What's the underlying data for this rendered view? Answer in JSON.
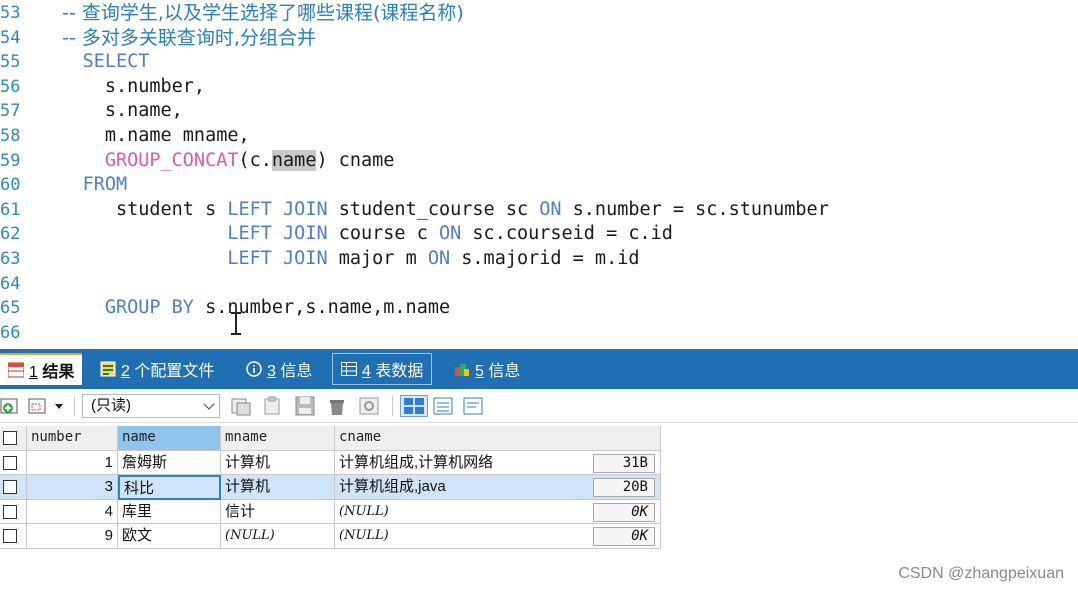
{
  "editor": {
    "lines": [
      {
        "no": "53",
        "parts": [
          {
            "t": "    -- 查询学生,以及学生选择了哪些课程(课程名称)",
            "c": "cm"
          }
        ]
      },
      {
        "no": "54",
        "parts": [
          {
            "t": "    -- 多对多关联查询时,分组合并",
            "c": "cm"
          }
        ]
      },
      {
        "no": "55",
        "parts": [
          {
            "t": "    ",
            "c": ""
          },
          {
            "t": "SELECT",
            "c": "kw"
          }
        ]
      },
      {
        "no": "56",
        "parts": [
          {
            "t": "      s.number,",
            "c": ""
          }
        ]
      },
      {
        "no": "57",
        "parts": [
          {
            "t": "      s.name,",
            "c": ""
          }
        ]
      },
      {
        "no": "58",
        "parts": [
          {
            "t": "      m.name mname,",
            "c": ""
          }
        ]
      },
      {
        "no": "59",
        "parts": [
          {
            "t": "      ",
            "c": ""
          },
          {
            "t": "GROUP_CONCAT",
            "c": "fn"
          },
          {
            "t": "(c.",
            "c": ""
          },
          {
            "t": "name",
            "c": "sel"
          },
          {
            "t": ") cname",
            "c": ""
          }
        ]
      },
      {
        "no": "60",
        "parts": [
          {
            "t": "    ",
            "c": ""
          },
          {
            "t": "FROM",
            "c": "kw"
          }
        ]
      },
      {
        "no": "61",
        "parts": [
          {
            "t": "       student s ",
            "c": ""
          },
          {
            "t": "LEFT JOIN",
            "c": "kw"
          },
          {
            "t": " student_course sc ",
            "c": ""
          },
          {
            "t": "ON",
            "c": "kw"
          },
          {
            "t": " s.number = sc.stunumber",
            "c": ""
          }
        ]
      },
      {
        "no": "62",
        "parts": [
          {
            "t": "                 ",
            "c": ""
          },
          {
            "t": "LEFT JOIN",
            "c": "kw"
          },
          {
            "t": " course c ",
            "c": ""
          },
          {
            "t": "ON",
            "c": "kw"
          },
          {
            "t": " sc.courseid = c.id",
            "c": ""
          }
        ]
      },
      {
        "no": "63",
        "parts": [
          {
            "t": "                 ",
            "c": ""
          },
          {
            "t": "LEFT JOIN",
            "c": "kw"
          },
          {
            "t": " major m ",
            "c": ""
          },
          {
            "t": "ON",
            "c": "kw"
          },
          {
            "t": " s.majorid = m.id",
            "c": ""
          }
        ]
      },
      {
        "no": "64",
        "parts": []
      },
      {
        "no": "65",
        "parts": [
          {
            "t": "      ",
            "c": ""
          },
          {
            "t": "GROUP BY",
            "c": "kw"
          },
          {
            "t": " s.number,s.name,m.name",
            "c": ""
          }
        ]
      },
      {
        "no": "66",
        "parts": []
      }
    ]
  },
  "tabs": [
    {
      "num": "1",
      "label": "结果",
      "active": true,
      "icon": "grid-result-icon"
    },
    {
      "num": "2",
      "label": "个配置文件",
      "active": false,
      "icon": "profile-icon"
    },
    {
      "num": "3",
      "label": "信息",
      "active": false,
      "icon": "info-icon"
    },
    {
      "num": "4",
      "label": "表数据",
      "active": false,
      "icon": "table-data-icon"
    },
    {
      "num": "5",
      "label": "信息",
      "active": false,
      "icon": "info-color-icon"
    }
  ],
  "toolbar": {
    "mode_value": "(只读)"
  },
  "grid": {
    "columns": [
      "number",
      "name",
      "mname",
      "cname"
    ],
    "rows": [
      {
        "number": "1",
        "name": "詹姆斯",
        "mname": "计算机",
        "cname": "计算机组成,计算机网络",
        "size": "31B",
        "mname_null": false,
        "cname_null": false
      },
      {
        "number": "3",
        "name": "科比",
        "mname": "计算机",
        "cname": "计算机组成,java",
        "size": "20B",
        "mname_null": false,
        "cname_null": false
      },
      {
        "number": "4",
        "name": "库里",
        "mname": "信计",
        "cname": "(NULL)",
        "size": "0K",
        "mname_null": false,
        "cname_null": true
      },
      {
        "number": "9",
        "name": "欧文",
        "mname": "(NULL)",
        "cname": "(NULL)",
        "size": "0K",
        "mname_null": true,
        "cname_null": true
      }
    ]
  },
  "watermark": "CSDN @zhangpeixuan",
  "colors": {
    "keyword": "#4d7ed0",
    "function": "#e05aa5",
    "comment": "#2a7fc4",
    "tabbar": "#1f6fb2"
  }
}
